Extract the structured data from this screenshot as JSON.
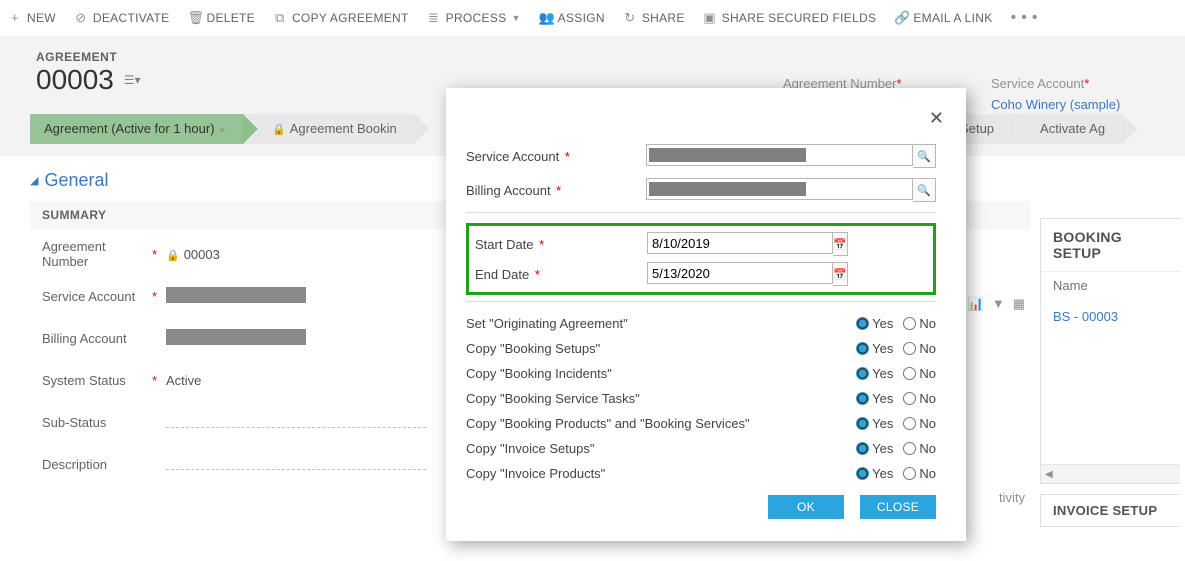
{
  "cmdbar": {
    "new": "NEW",
    "deactivate": "DEACTIVATE",
    "delete": "DELETE",
    "copy": "COPY AGREEMENT",
    "process": "PROCESS",
    "assign": "ASSIGN",
    "share": "SHARE",
    "share_secured": "SHARE SECURED FIELDS",
    "email": "EMAIL A LINK",
    "overflow": "• • •"
  },
  "header": {
    "entity": "AGREEMENT",
    "record": "00003",
    "viewsel_icon": "☰▾",
    "summary": {
      "agr_lbl": "Agreement Number",
      "agr_val": "00003",
      "svc_lbl": "Service Account",
      "svc_val": "Coho Winery (sample)"
    }
  },
  "chevrons": {
    "c1": "Agreement (Active for 1 hour)",
    "c2": "Agreement Bookin",
    "c3": "ce Setup",
    "c4": "Activate Ag"
  },
  "section": {
    "general": "General",
    "summary": "SUMMARY"
  },
  "form": {
    "agr_lbl": "Agreement Number",
    "agr_val": "00003",
    "svc_lbl": "Service Account",
    "bill_lbl": "Billing Account",
    "status_lbl": "System Status",
    "status_val": "Active",
    "sub_lbl": "Sub-Status",
    "desc_lbl": "Description"
  },
  "right": {
    "booking_setup": "BOOKING SETUP",
    "name_col": "Name",
    "bs_item": "BS - 00003",
    "invoice_setup": "INVOICE SETUP",
    "activity": "tivity"
  },
  "modal": {
    "svc_lbl": "Service Account",
    "bill_lbl": "Billing Account",
    "start_lbl": "Start Date",
    "start_val": "8/10/2019",
    "end_lbl": "End Date",
    "end_val": "5/13/2020",
    "opts": {
      "orig": "Set \"Originating Agreement\"",
      "bsetup": "Copy \"Booking Setups\"",
      "binc": "Copy \"Booking Incidents\"",
      "btask": "Copy \"Booking Service Tasks\"",
      "bprod": "Copy \"Booking Products\" and \"Booking Services\"",
      "isetup": "Copy \"Invoice Setups\"",
      "iprod": "Copy \"Invoice Products\""
    },
    "yes": "Yes",
    "no": "No",
    "ok": "OK",
    "close": "CLOSE"
  }
}
